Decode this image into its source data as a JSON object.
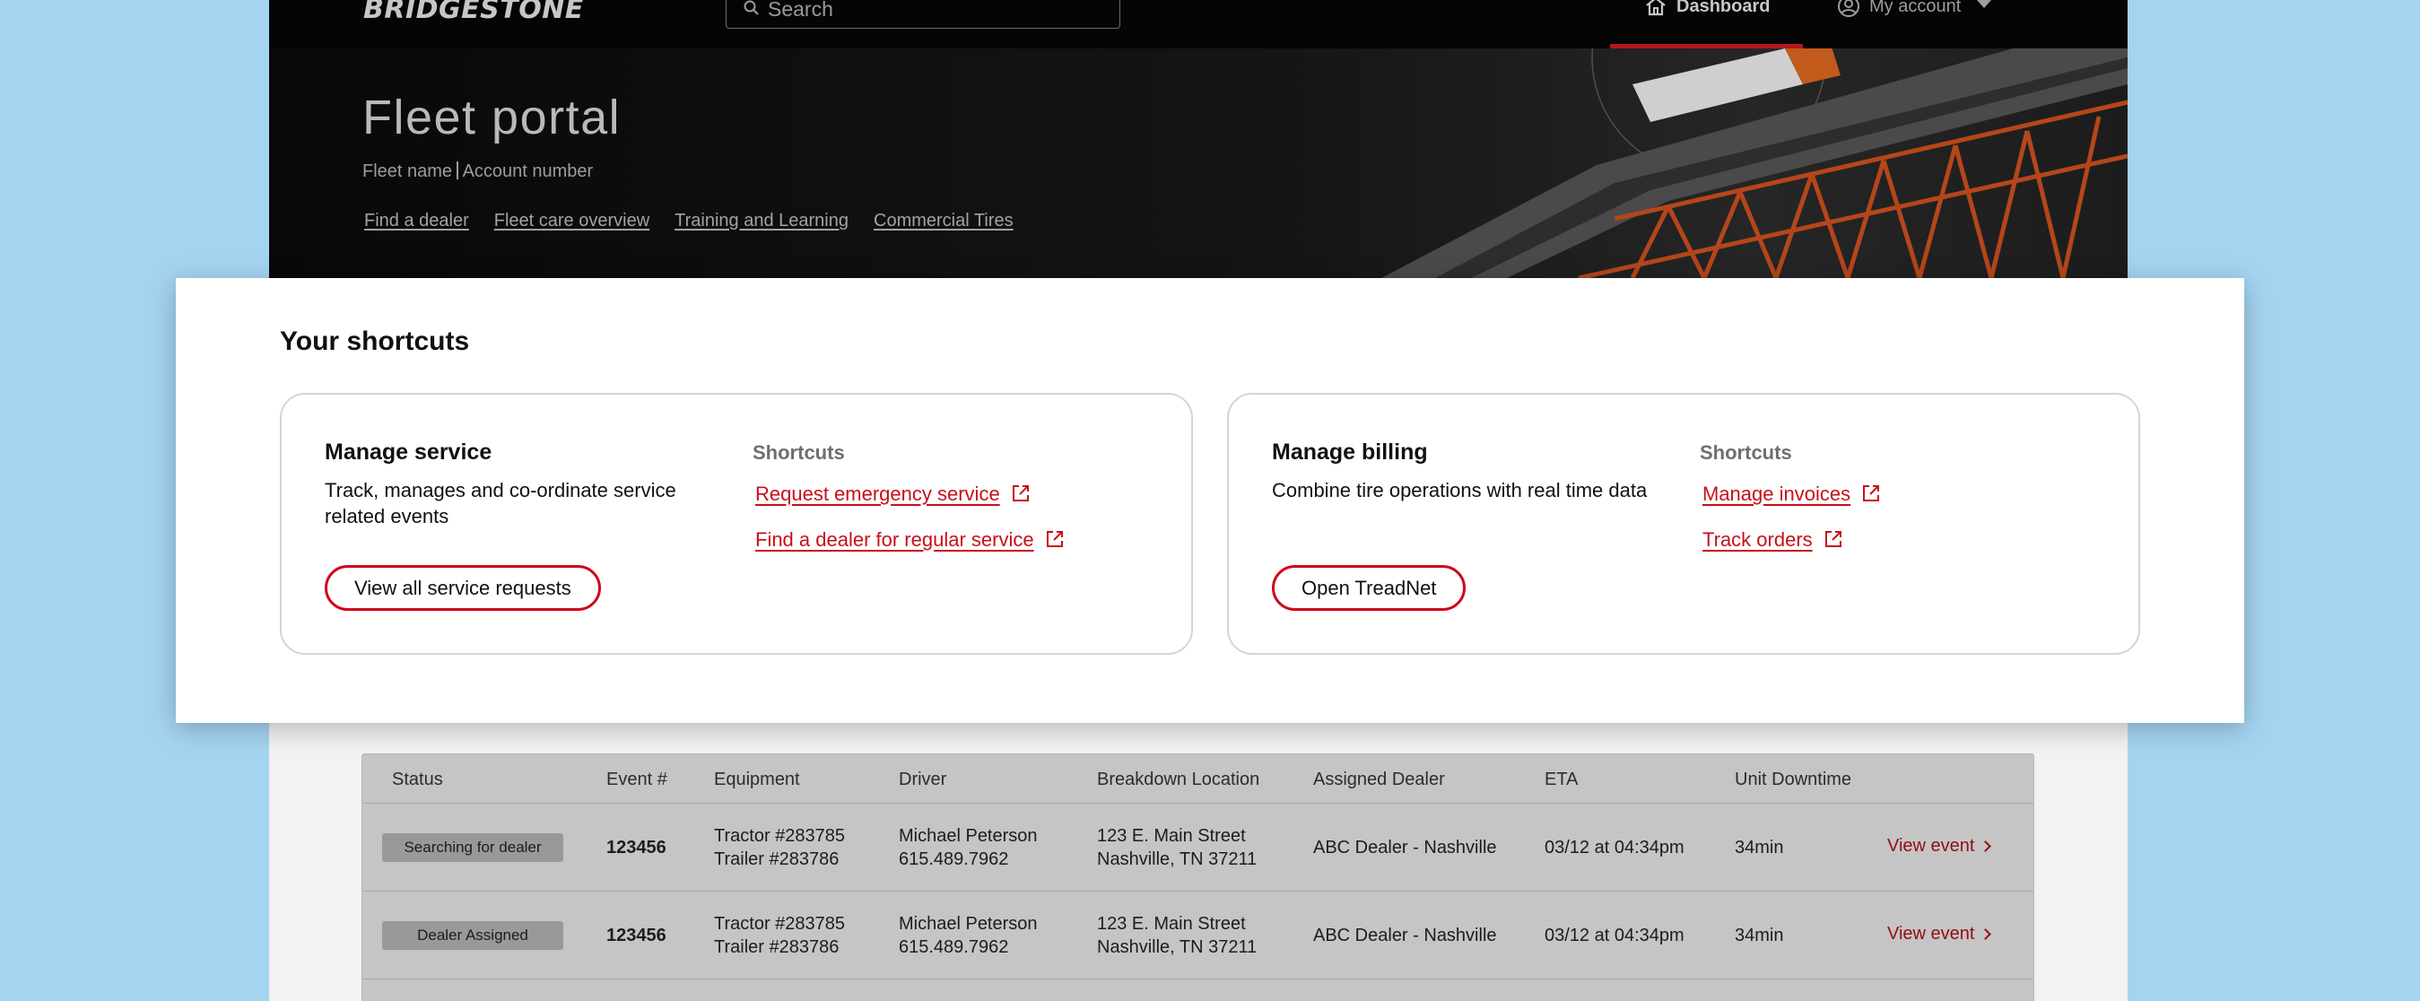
{
  "nav": {
    "logo": "BRIDGESTONE",
    "search_placeholder": "Search",
    "dashboard_label": "Dashboard",
    "account_label": "My account"
  },
  "hero": {
    "title": "Fleet portal",
    "fleet_name": "Fleet name",
    "account_number": "Account number",
    "links": [
      "Find a dealer",
      "Fleet care overview",
      "Training and Learning",
      "Commercial Tires"
    ]
  },
  "shortcuts": {
    "title": "Your shortcuts",
    "cards": [
      {
        "title": "Manage service",
        "description": "Track, manages and co-ordinate service related events",
        "button": "View all service requests",
        "shortcuts_heading": "Shortcuts",
        "links": [
          "Request emergency service",
          "Find a dealer for regular service"
        ]
      },
      {
        "title": "Manage billing",
        "description": "Combine tire operations with real time data",
        "button": "Open TreadNet",
        "shortcuts_heading": "Shortcuts",
        "links": [
          "Manage invoices",
          "Track orders"
        ]
      }
    ]
  },
  "table": {
    "columns": [
      "Status",
      "Event #",
      "Equipment",
      "Driver",
      "Breakdown Location",
      "Assigned Dealer",
      "ETA",
      "Unit Downtime"
    ],
    "rows": [
      {
        "status": "Searching for dealer",
        "event": "123456",
        "equipment": [
          "Tractor #283785",
          "Trailer #283786"
        ],
        "driver": [
          "Michael Peterson",
          "615.489.7962"
        ],
        "location": [
          "123 E. Main Street",
          "Nashville, TN 37211"
        ],
        "dealer": "ABC Dealer - Nashville",
        "eta": "03/12 at 04:34pm",
        "downtime": "34min",
        "action": "View event"
      },
      {
        "status": "Dealer Assigned",
        "event": "123456",
        "equipment": [
          "Tractor #283785",
          "Trailer #283786"
        ],
        "driver": [
          "Michael Peterson",
          "615.489.7962"
        ],
        "location": [
          "123 E. Main Street",
          "Nashville, TN 37211"
        ],
        "dealer": "ABC Dealer - Nashville",
        "eta": "03/12 at 04:34pm",
        "downtime": "34min",
        "action": "View event"
      }
    ]
  },
  "colors": {
    "accent_red": "#d0021b",
    "link_red": "#c7101a",
    "page_background": "#a5d4f1"
  }
}
